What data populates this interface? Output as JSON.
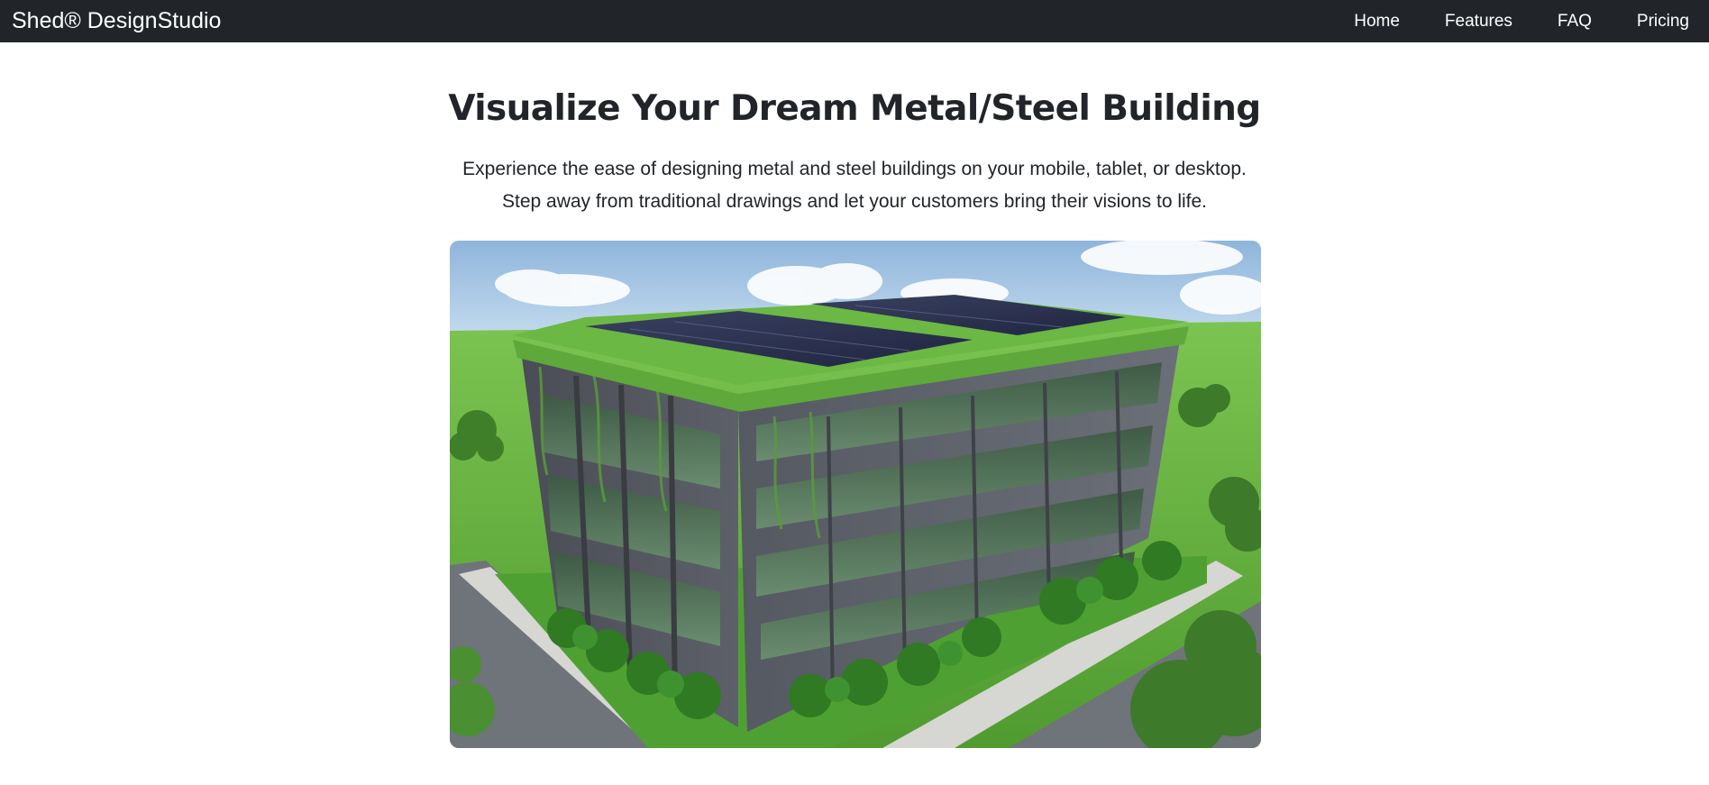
{
  "navbar": {
    "brand": "Shed® DesignStudio",
    "links": [
      {
        "label": "Home"
      },
      {
        "label": "Features"
      },
      {
        "label": "FAQ"
      },
      {
        "label": "Pricing"
      }
    ],
    "background": "#212529"
  },
  "hero": {
    "title": "Visualize Your Dream Metal/Steel Building",
    "subtitle_line1": "Experience the ease of designing metal and steel buildings on your mobile, tablet, or desktop.",
    "subtitle_line2": "Step away from traditional drawings and let your customers bring their visions to life."
  },
  "colors": {
    "text": "#212529",
    "sky": "#9bbfe0",
    "grass": "#5fae3a",
    "building": "#5b5e66"
  }
}
